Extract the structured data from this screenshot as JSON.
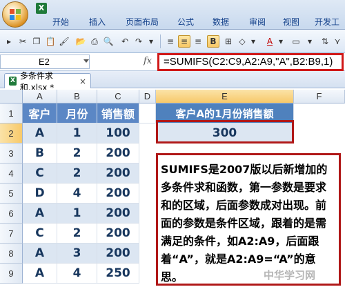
{
  "ribbon": {
    "tabs": [
      "开始",
      "插入",
      "页面布局",
      "公式",
      "数据",
      "审阅",
      "视图",
      "开发工"
    ]
  },
  "formula_bar": {
    "name_box": "E2",
    "fx_label": "fx",
    "formula": "=SUMIFS(C2:C9,A2:A9,\"A\",B2:B9,1)"
  },
  "document": {
    "tab_name": "多条件求和.xlsx *",
    "close_label": "×"
  },
  "grid": {
    "columns": [
      "A",
      "B",
      "C",
      "D",
      "E",
      "F"
    ],
    "rows": [
      "1",
      "2",
      "3",
      "4",
      "5",
      "6",
      "7",
      "8",
      "9"
    ],
    "table_headers": [
      "客户",
      "月份",
      "销售额"
    ],
    "table_rows": [
      [
        "A",
        "1",
        "100"
      ],
      [
        "B",
        "2",
        "200"
      ],
      [
        "C",
        "2",
        "200"
      ],
      [
        "D",
        "4",
        "200"
      ],
      [
        "A",
        "1",
        "200"
      ],
      [
        "C",
        "2",
        "200"
      ],
      [
        "A",
        "3",
        "200"
      ],
      [
        "A",
        "4",
        "250"
      ]
    ],
    "result_header": "客户A的1月份销售额",
    "result_value": "300"
  },
  "note": {
    "text": "SUMIFS是2007版以后新增加的多条件求和函数，第一参数是要求和的区域，后面参数成对出现。前面的参数是条件区域，跟着的是需满足的条件，如A2:A9，后面跟着“A”，就是A2:A9=“A”的意思。"
  },
  "watermark": "中华学习网",
  "colors": {
    "header_blue": "#5b87c5",
    "band_blue": "#dce6f2",
    "highlight_red": "#b01818"
  }
}
